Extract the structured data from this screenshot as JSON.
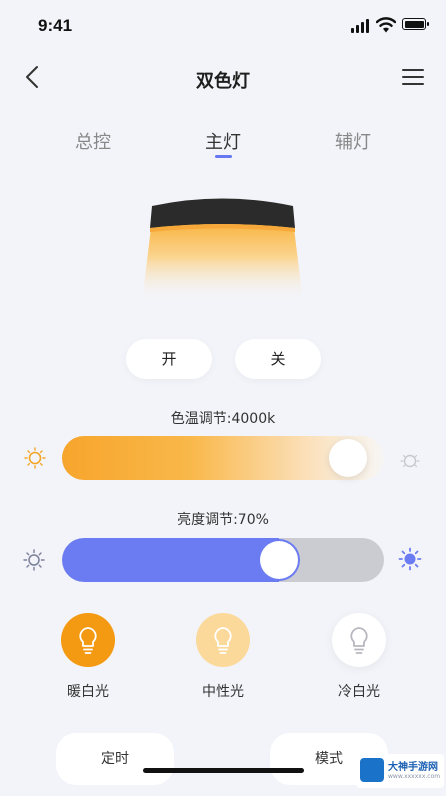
{
  "status_bar": {
    "time": "9:41"
  },
  "header": {
    "title": "双色灯"
  },
  "tabs": [
    {
      "label": "总控",
      "active": false
    },
    {
      "label": "主灯",
      "active": true
    },
    {
      "label": "辅灯",
      "active": false
    }
  ],
  "power": {
    "on_label": "开",
    "off_label": "关"
  },
  "color_temp": {
    "label": "色温调节:4000k",
    "level": 0.95
  },
  "brightness": {
    "label": "亮度调节:70%",
    "value": 70
  },
  "modes": [
    {
      "label": "暖白光",
      "color": "#f39a12",
      "icon": "bulb-icon"
    },
    {
      "label": "中性光",
      "color": "#fbd99a",
      "icon": "bulb-icon"
    },
    {
      "label": "冷白光",
      "color": "#ffffff",
      "icon": "bulb-icon"
    }
  ],
  "bottom": {
    "timer_label": "定时",
    "mode_label": "模式"
  },
  "watermark": {
    "text": "大神手游网",
    "sub": "www.xxxxxx.com"
  },
  "colors": {
    "accent": "#6b7cf2",
    "warm": "#f7a52c"
  }
}
